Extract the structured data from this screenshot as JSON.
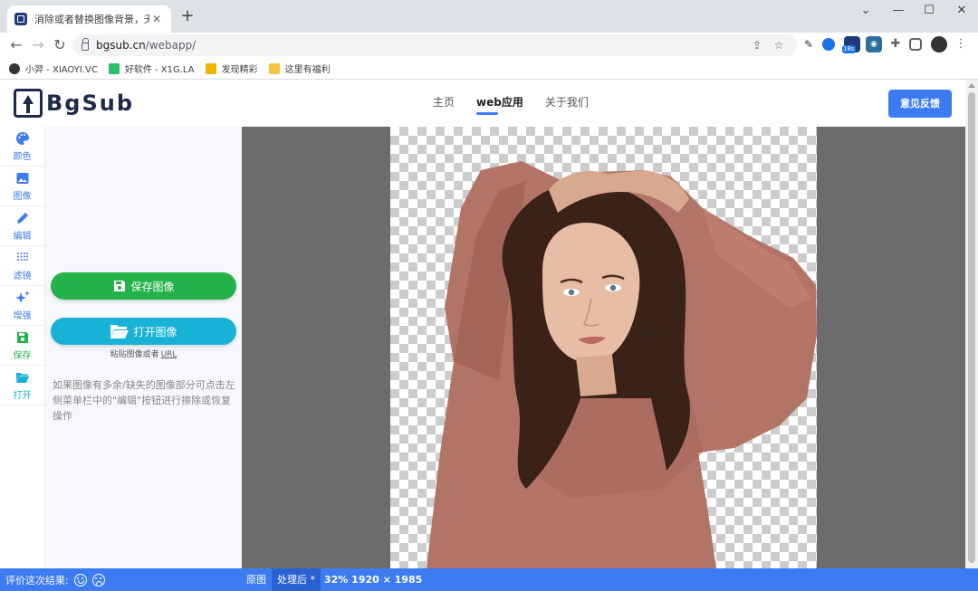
{
  "browser": {
    "tab_title": "消除或者替换图像背景，无需上传",
    "url_host": "bgsub.cn",
    "url_path": "/webapp/",
    "extension_badge": "18s",
    "bookmarks": [
      {
        "label": "小羿 - XIAOYI.VC",
        "icon_color": "#333333"
      },
      {
        "label": "好软件 - X1G.LA",
        "icon_color": "#2dbd6e"
      },
      {
        "label": "发现精彩",
        "icon_color": "#f0b400"
      },
      {
        "label": "这里有福利",
        "icon_color": "#f5c542"
      }
    ]
  },
  "site": {
    "logo_text": "BgSub",
    "nav": [
      {
        "label": "主页",
        "active": false
      },
      {
        "label": "web应用",
        "active": true
      },
      {
        "label": "关于我们",
        "active": false
      }
    ],
    "feedback_label": "意见反馈"
  },
  "rail": {
    "items": [
      {
        "id": "color",
        "label": "颜色",
        "icon": "palette-icon"
      },
      {
        "id": "image",
        "label": "图像",
        "icon": "image-icon"
      },
      {
        "id": "edit",
        "label": "编辑",
        "icon": "pencil-icon"
      },
      {
        "id": "filter",
        "label": "滤镜",
        "icon": "filter-grid-icon"
      },
      {
        "id": "enhance",
        "label": "增强",
        "icon": "sparkle-icon"
      },
      {
        "id": "save",
        "label": "保存",
        "icon": "floppy-icon"
      },
      {
        "id": "open",
        "label": "打开",
        "icon": "folder-open-icon"
      }
    ]
  },
  "panel": {
    "save_label": "保存图像",
    "open_label": "打开图像",
    "paste_hint": "粘贴图像或者",
    "paste_url": "URL",
    "note": "如果图像有多余/缺失的图像部分可点击左侧菜单栏中的\"编辑\"按钮进行擦除或恢复操作"
  },
  "statusbar": {
    "rate_label": "评价这次结果:",
    "view_original": "原图",
    "view_processed": "处理后 *",
    "info": "32% 1920 × 1985"
  },
  "colors": {
    "accent": "#3d7bf2",
    "save_green": "#24b24a",
    "open_cyan": "#18b2d6"
  }
}
